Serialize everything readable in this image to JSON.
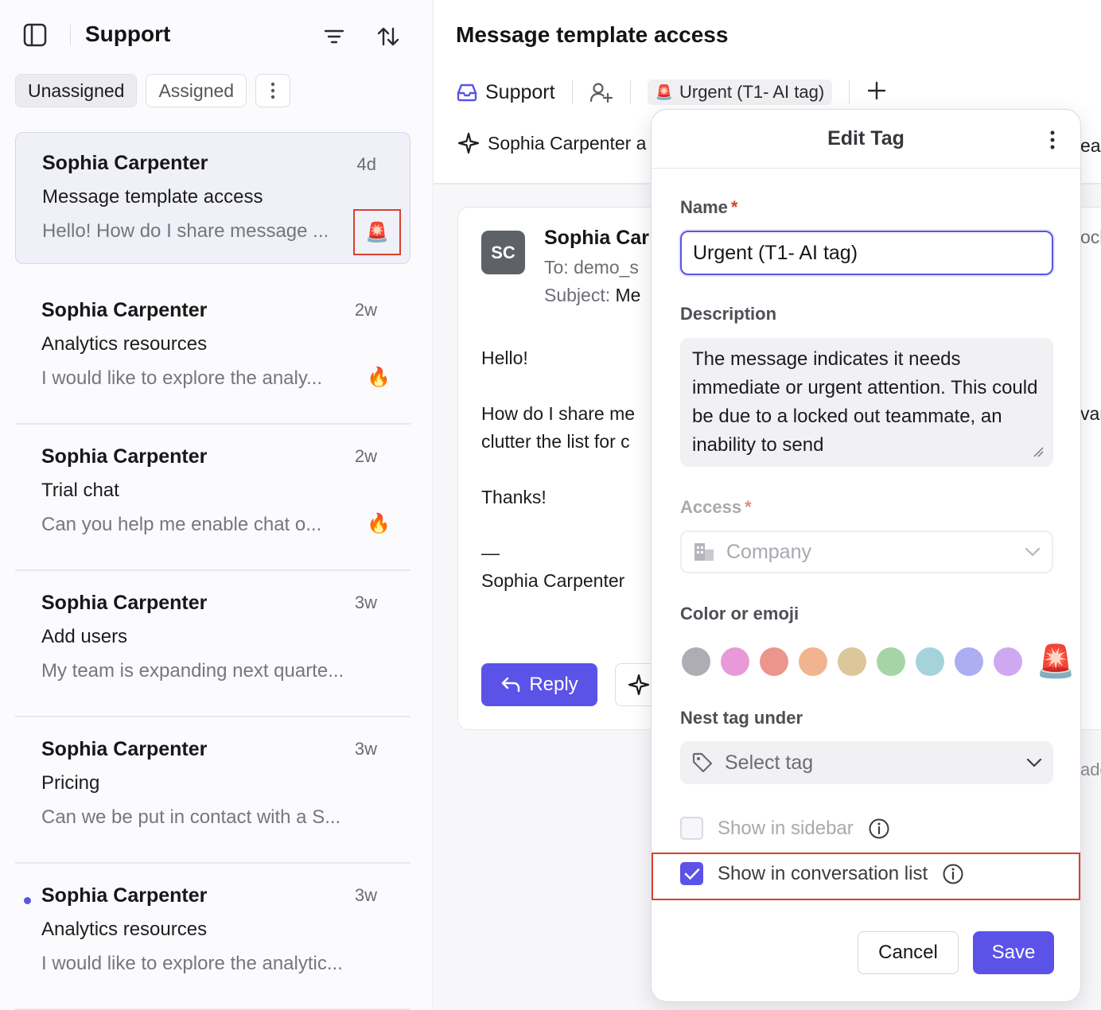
{
  "sidebar": {
    "title": "Support",
    "tabs": [
      {
        "label": "Unassigned",
        "active": true
      },
      {
        "label": "Assigned",
        "active": false
      }
    ],
    "conversations": [
      {
        "name": "Sophia Carpenter",
        "time": "4d",
        "subject": "Message template access",
        "preview": "Hello! How do I share message ...",
        "tag_icon": "🚨",
        "selected": true,
        "unread": false
      },
      {
        "name": "Sophia Carpenter",
        "time": "2w",
        "subject": "Analytics resources",
        "preview": "I would like to explore the analy...",
        "tag_icon": "🔥",
        "selected": false,
        "unread": false
      },
      {
        "name": "Sophia Carpenter",
        "time": "2w",
        "subject": "Trial chat",
        "preview": "Can you help me enable chat o...",
        "tag_icon": "🔥",
        "selected": false,
        "unread": false
      },
      {
        "name": "Sophia Carpenter",
        "time": "3w",
        "subject": "Add users",
        "preview": "My team is expanding next quarte...",
        "tag_icon": "",
        "selected": false,
        "unread": false
      },
      {
        "name": "Sophia Carpenter",
        "time": "3w",
        "subject": "Pricing",
        "preview": "Can we be put in contact with a S...",
        "tag_icon": "",
        "selected": false,
        "unread": false
      },
      {
        "name": "Sophia Carpenter",
        "time": "3w",
        "subject": "Analytics resources",
        "preview": "I would like to explore the analytic...",
        "tag_icon": "",
        "selected": false,
        "unread": true
      }
    ]
  },
  "main": {
    "title": "Message template access",
    "inbox_label": "Support",
    "tag_chip": {
      "emoji": "🚨",
      "label": "Urgent (T1- AI tag)"
    },
    "summary_text": "Sophia Carpenter a",
    "summary_tail": "ea",
    "message": {
      "avatar_initials": "SC",
      "sender": "Sophia Car",
      "to": "To: demo_s",
      "subject_prefix": "Subject: ",
      "subject_value": "Me",
      "body_lines": [
        "Hello!",
        "",
        "How do I share me",
        "clutter the list for c",
        "",
        "Thanks!",
        "",
        "—",
        "Sophia Carpenter"
      ],
      "reply_label": "Reply",
      "clip_right_1": "ocl",
      "clip_right_2": "var",
      "clip_right_3": "add"
    }
  },
  "edit_tag": {
    "title": "Edit Tag",
    "name_label": "Name",
    "required_mark": "*",
    "name_value": "Urgent (T1- AI tag)",
    "description_label": "Description",
    "description_value": "The message indicates it needs immediate or urgent attention. This could be due to a locked out teammate, an inability to send",
    "access_label": "Access",
    "access_value": "Company",
    "color_label": "Color or emoji",
    "swatch_colors": [
      "#adadb3",
      "#e89ad8",
      "#ec958d",
      "#f2b48e",
      "#dcc79a",
      "#a6d4a6",
      "#a4d3dc",
      "#adadf2",
      "#cfa8f2"
    ],
    "selected_emoji": "🚨",
    "nest_label": "Nest tag under",
    "nest_placeholder": "Select tag",
    "show_sidebar_label": "Show in sidebar",
    "show_sidebar_checked": false,
    "show_list_label": "Show in conversation list",
    "show_list_checked": true,
    "cancel_label": "Cancel",
    "save_label": "Save"
  }
}
